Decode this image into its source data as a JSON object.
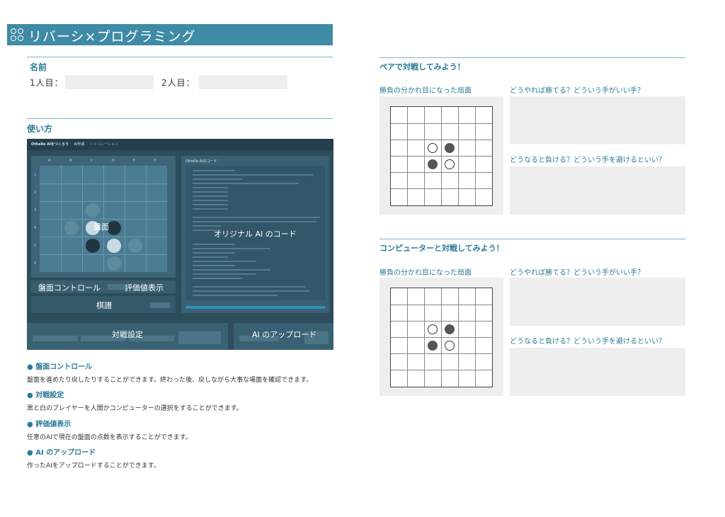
{
  "title": "リバーシ×プログラミング",
  "name_section": {
    "heading": "名前",
    "player1_label": "1人目：",
    "player2_label": "2人目："
  },
  "usage_section": {
    "heading": "使い方",
    "app_title": "Othello AIをつくろう",
    "app_tab1": "AI作成",
    "app_tab2": "シミュレーション",
    "code_panel_title": "Othello AIのコード",
    "col_labels": [
      "A",
      "B",
      "C",
      "D",
      "E",
      "F"
    ],
    "row_labels": [
      "1",
      "2",
      "3",
      "4",
      "5",
      "6"
    ],
    "overlay_board": "盤面",
    "overlay_code": "オリジナル AI のコード",
    "overlay_control": "盤面コントロール",
    "overlay_eval": "評価値表示",
    "overlay_kifu": "棋譜",
    "overlay_battle": "対戦設定",
    "overlay_upload": "AI のアップロード"
  },
  "explanations": [
    {
      "heading": "● 盤面コントロール",
      "text": "盤面を進めたり戻したりすることができます。終わった後、戻しながら大事な場面を確認できます。"
    },
    {
      "heading": "● 対戦設定",
      "text": "黒と白のプレイヤーを人間かコンピューターの選択をすることができます。"
    },
    {
      "heading": "● 評価値表示",
      "text": "任意のAIで現在の盤面の点数を表示することができます。"
    },
    {
      "heading": "● AI のアップロード",
      "text": "作ったAIをアップロードすることができます。"
    }
  ],
  "pair_section": {
    "heading": "ペアで対戦してみよう！",
    "board_label": "勝負の分かれ目になった局面",
    "q_win": "どうやれば勝てる？どういう手がいい手？",
    "q_lose": "どうなると負ける？どういう手を避けるといい？"
  },
  "cpu_section": {
    "heading": "コンピューターと対戦してみよう！",
    "board_label": "勝負の分かれ目になった局面",
    "q_win": "どうやれば勝てる？どういう手がいい手？",
    "q_lose": "どうなると負ける？どういう手を避けるといい？"
  },
  "colors": {
    "accent": "#3f8ba6",
    "heading_text": "#2b7a98",
    "rule": "#7fb4c6",
    "box_gray": "#eeeeee",
    "app_bg": "#2d4c5c"
  },
  "icons": [
    "logo-rings-icon"
  ]
}
